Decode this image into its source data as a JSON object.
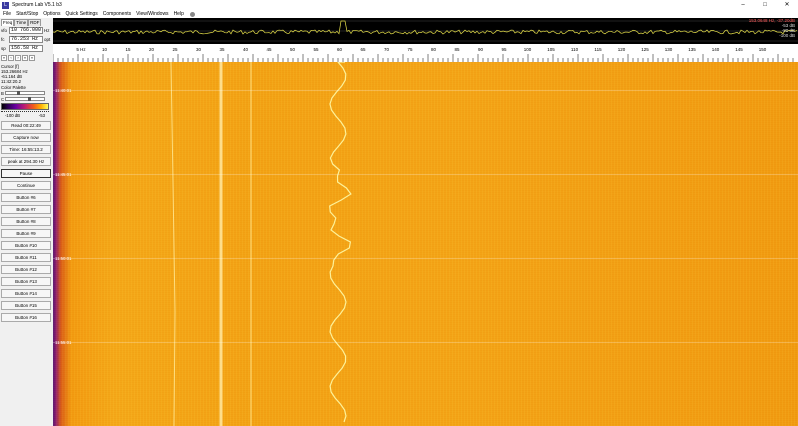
{
  "window": {
    "title": "Spectrum Lab V5.1 b3",
    "controls": [
      "–",
      "□",
      "✕"
    ]
  },
  "menu": [
    "File",
    "Start/Stop",
    "Options",
    "Quick Settings",
    "Components",
    "View/Windows",
    "Help"
  ],
  "left": {
    "tabs": [
      "Freq",
      "Time",
      "RDF"
    ],
    "fields": [
      {
        "label": "vfo",
        "value": "10 766.000",
        "unit": "Hz"
      },
      {
        "label": "fc",
        "value": "76.253 Hz",
        "unit": "opt"
      },
      {
        "label": "sp",
        "value": "156.58 Hz",
        "unit": ""
      }
    ],
    "nav_glyphs": [
      "«",
      "‹",
      "›",
      "»",
      "»"
    ],
    "cursor": {
      "title": "Cursor [f]",
      "lines": [
        "153.26684 Hz",
        "-61.164 dB",
        "11:42:20.2"
      ]
    },
    "palette": {
      "title": "Color Palette",
      "rows": [
        {
          "label": "B",
          "thumb_pos": 0.3
        },
        {
          "label": "C",
          "thumb_pos": 0.6
        }
      ],
      "db_left": "-100 dB",
      "db_right": "-53"
    },
    "buttons": [
      "Read 00:22:49",
      "Capture now",
      "Time:  16:55:13.2",
      "peak at 294.30 Hz",
      "Pause",
      "Continue",
      "Button #6",
      "Button #7",
      "Button #8",
      "Button #9",
      "Button #10",
      "Button #11",
      "Button #12",
      "Button #13",
      "Button #14",
      "Button #15",
      "Button #16"
    ],
    "strong_buttons": [
      4
    ]
  },
  "spectrum": {
    "readout_lines": [
      "153.0648 Hz, -37.20dB",
      "-53 dB",
      "-80 dB",
      "-100 dB"
    ]
  },
  "axis": {
    "ticks": [
      "5 Hz",
      "10",
      "15",
      "20",
      "25",
      "30",
      "35",
      "40",
      "45",
      "50",
      "55",
      "60",
      "65",
      "70",
      "75",
      "80",
      "85",
      "90",
      "95",
      "100",
      "105",
      "110",
      "115",
      "120",
      "125",
      "130",
      "135",
      "140",
      "145",
      "150"
    ],
    "tick_pos": [
      0.04,
      0.07,
      0.11,
      0.15,
      0.2,
      0.25,
      0.3,
      0.35,
      0.4,
      0.45,
      0.5,
      0.55,
      0.6,
      0.65,
      0.7,
      0.75,
      0.8,
      0.85,
      0.9,
      0.95,
      1.0,
      1.05,
      1.1,
      1.15,
      1.2,
      1.25,
      1.3,
      1.35,
      1.4,
      1.45
    ]
  },
  "waterfall": {
    "time_labels": [
      "11:40:01",
      "11:45:01",
      "11:50:01",
      "11:55:01"
    ],
    "colors": {
      "bg": "#f4a818",
      "line": "#ffffb0"
    }
  }
}
